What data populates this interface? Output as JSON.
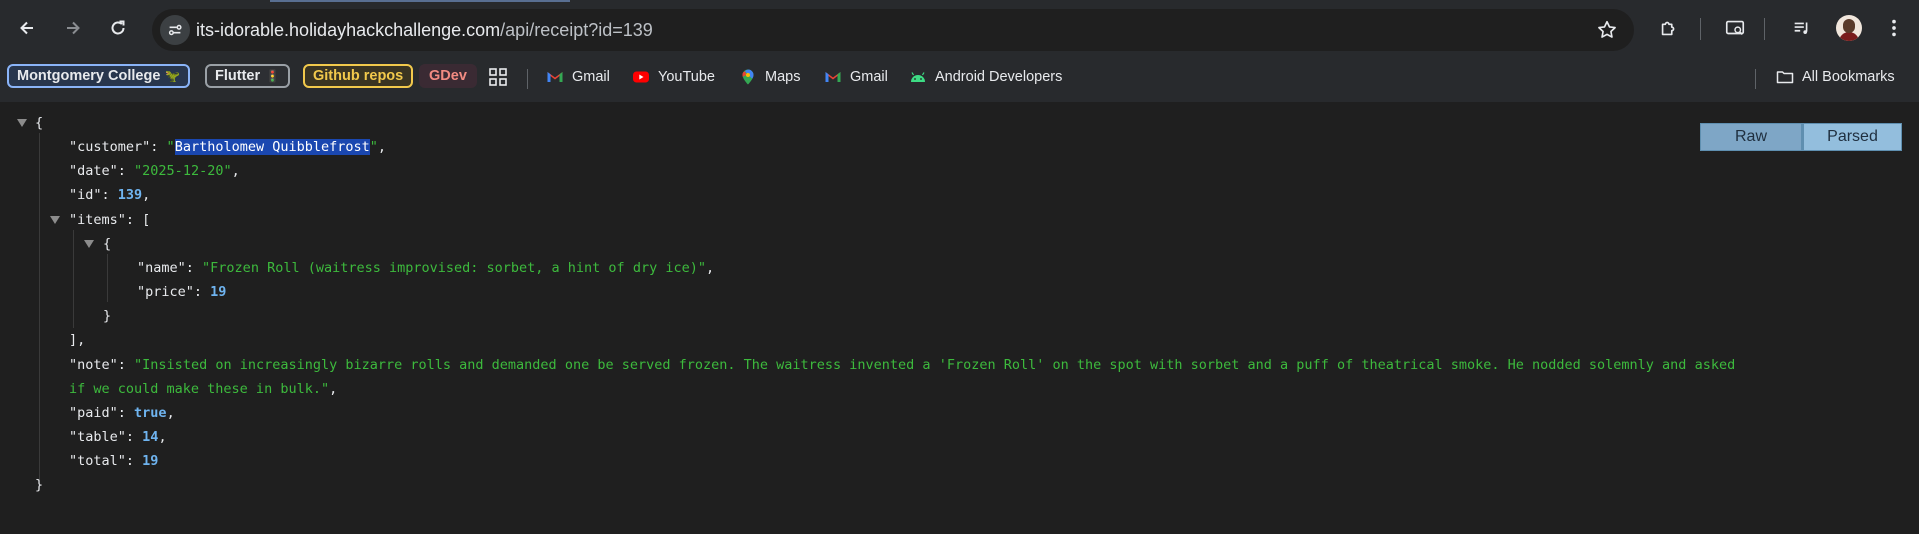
{
  "browser": {
    "url_host_main": "its-idorable.holidayhackchallenge.com",
    "url_path": "/api/receipt?id=139",
    "icons": [
      "back-icon",
      "forward-icon",
      "reload-icon",
      "site-info-icon",
      "star-icon",
      "extensions-icon",
      "media-cast-icon",
      "reading-list-icon",
      "profile-avatar",
      "menu-icon"
    ]
  },
  "bookmarks": {
    "chips": [
      {
        "label": "Montgomery College",
        "color": "#8ab4f8",
        "bg": "#28364d",
        "emoji": "🦖"
      },
      {
        "label": "Flutter",
        "color": "#e8eaed",
        "bg": "#2d2f33",
        "emoji": "🚦"
      },
      {
        "label": "Github repos",
        "color": "#f2c94c",
        "bg": "#3a3422"
      },
      {
        "label": "GDev",
        "color": "#f28b82",
        "bg": "#3a2a33"
      }
    ],
    "links": [
      "Gmail",
      "YouTube",
      "Maps",
      "Gmail",
      "Android Developers"
    ],
    "all_bookmarks": "All Bookmarks"
  },
  "viewer": {
    "raw_label": "Raw",
    "parsed_label": "Parsed",
    "json": {
      "customer_key": "\"customer\"",
      "customer_value": "Bartholomew Quibblefrost",
      "date_key": "\"date\"",
      "date_value": "\"2025-12-20\"",
      "id_key": "\"id\"",
      "id_value": "139",
      "items_key": "\"items\"",
      "item_name_key": "\"name\"",
      "item_name_value": "\"Frozen Roll (waitress improvised: sorbet, a hint of dry ice)\"",
      "item_price_key": "\"price\"",
      "item_price_value": "19",
      "note_key": "\"note\"",
      "note_value_line1": "\"Insisted on increasingly bizarre rolls and demanded one be served frozen. The waitress invented a 'Frozen Roll' on the spot with sorbet and a puff of theatrical smoke. He nodded solemnly and asked",
      "note_value_line2": "if we could make these in bulk.\"",
      "paid_key": "\"paid\"",
      "paid_value": "true",
      "table_key": "\"table\"",
      "table_value": "14",
      "total_key": "\"total\"",
      "total_value": "19"
    }
  }
}
